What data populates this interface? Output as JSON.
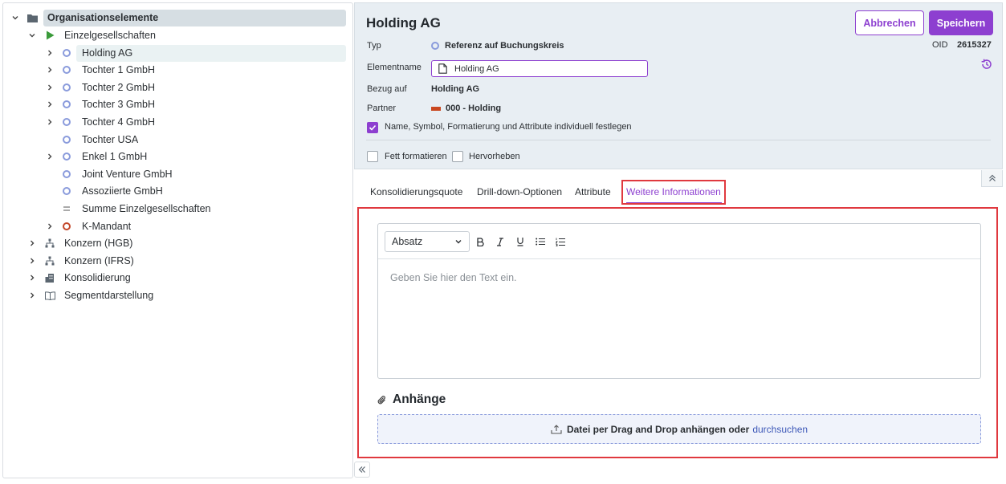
{
  "tree": {
    "root": {
      "label": "Organisationselemente"
    },
    "einzel": {
      "label": "Einzelgesellschaften"
    },
    "children": [
      {
        "label": "Holding AG"
      },
      {
        "label": "Tochter 1 GmbH"
      },
      {
        "label": "Tochter 2 GmbH"
      },
      {
        "label": "Tochter 3 GmbH"
      },
      {
        "label": "Tochter 4 GmbH"
      },
      {
        "label": "Tochter USA"
      },
      {
        "label": "Enkel 1 GmbH"
      },
      {
        "label": "Joint Venture GmbH"
      },
      {
        "label": "Assoziierte GmbH"
      },
      {
        "label": "Summe Einzelgesellschaften"
      },
      {
        "label": "K-Mandant"
      }
    ],
    "groups": [
      {
        "label": "Konzern (HGB)"
      },
      {
        "label": "Konzern (IFRS)"
      },
      {
        "label": "Konsolidierung"
      },
      {
        "label": "Segmentdarstellung"
      }
    ]
  },
  "header": {
    "title": "Holding AG",
    "cancel_label": "Abbrechen",
    "save_label": "Speichern",
    "typ_label": "Typ",
    "typ_value": "Referenz auf Buchungskreis",
    "name_label": "Elementname",
    "name_value": "Holding AG",
    "bezug_label": "Bezug auf",
    "bezug_value": "Holding AG",
    "partner_label": "Partner",
    "partner_value": "000 - Holding",
    "oid_label": "OID",
    "oid_value": "2615327",
    "individual_label": "Name, Symbol, Formatierung und Attribute individuell festlegen",
    "bold_label": "Fett formatieren",
    "highlight_label": "Hervorheben"
  },
  "tabs": [
    {
      "label": "Konsolidierungsquote"
    },
    {
      "label": "Drill-down-Optionen"
    },
    {
      "label": "Attribute"
    },
    {
      "label": "Weitere Informationen"
    }
  ],
  "editor": {
    "format_value": "Absatz",
    "placeholder": "Geben Sie hier den Text ein."
  },
  "attachments": {
    "title": "Anhänge",
    "drop_text": "Datei per Drag and Drop anhängen oder",
    "browse_link": "durchsuchen"
  },
  "colors": {
    "accent": "#8d3fd0",
    "annotation": "#e0393f",
    "partner_swatch": "#c9471f",
    "node_ring": "#8a9bdc"
  }
}
